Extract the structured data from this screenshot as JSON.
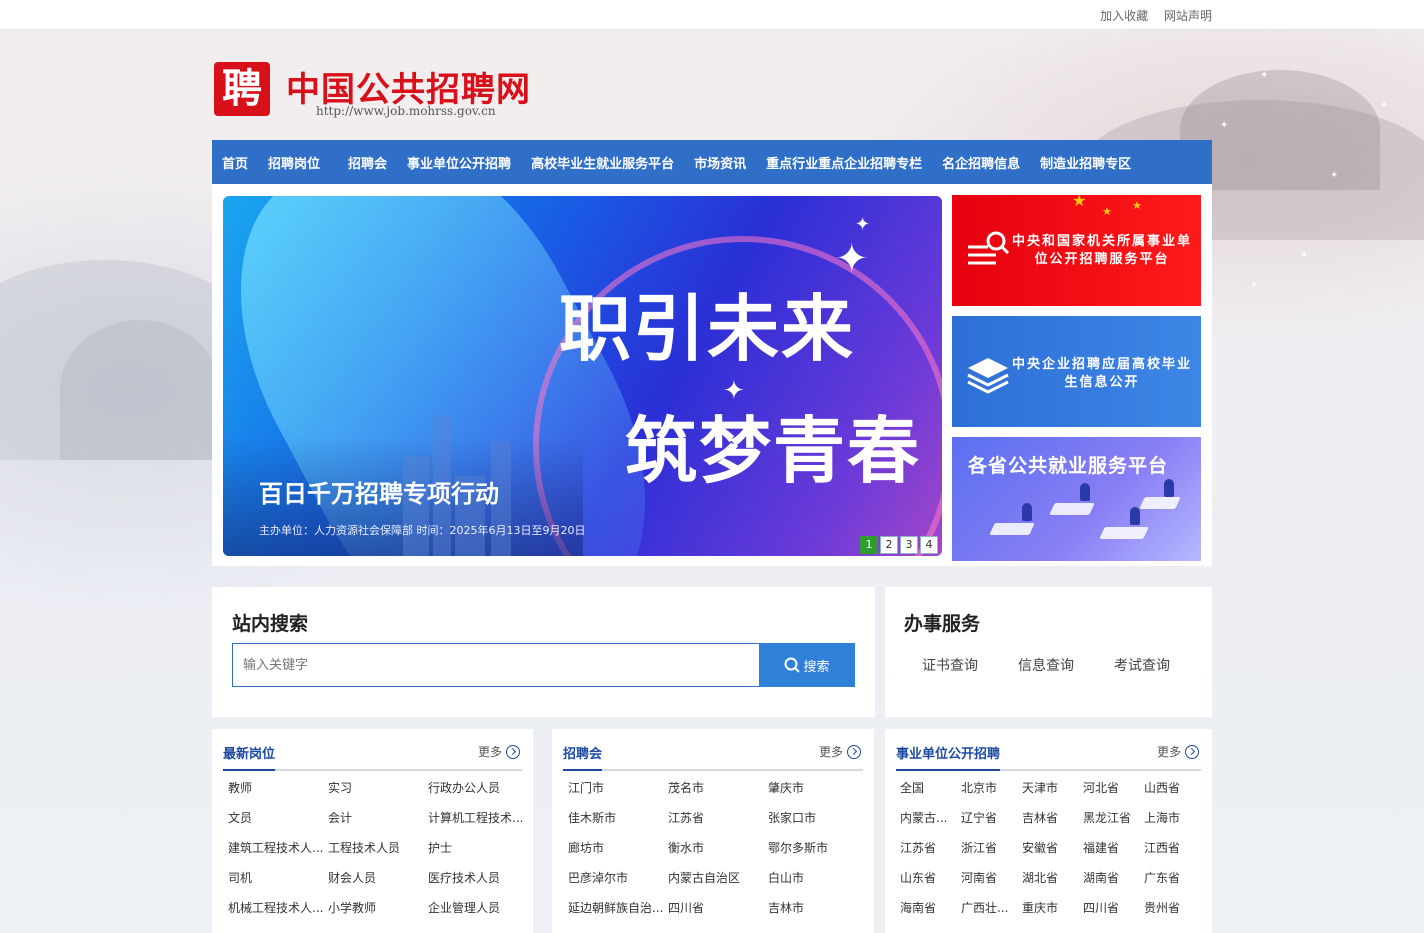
{
  "topbar": {
    "links": [
      "加入收藏",
      "网站声明"
    ]
  },
  "logo": {
    "mark": "聘",
    "title": "中国公共招聘网",
    "url": "http://www.job.mohrss.gov.cn"
  },
  "nav": [
    "首页",
    "招聘岗位",
    "招聘会",
    "事业单位公开招聘",
    "高校毕业生就业服务平台",
    "市场资讯",
    "重点行业重点企业招聘专栏",
    "名企招聘信息",
    "制造业招聘专区"
  ],
  "carousel": {
    "line1": "职引未来",
    "line2": "筑梦青春",
    "subtitle": "百日千万招聘专项行动",
    "sponsor": "主办单位：人力资源社会保障部    时间：2025年6月13日至9月20日",
    "dots": [
      "1",
      "2",
      "3",
      "4"
    ],
    "active_dot": 1
  },
  "side_banners": [
    {
      "text": "中央和国家机关所属事业单位公开招聘服务平台",
      "icon": "search-list-icon",
      "color": "#e5000f"
    },
    {
      "text": "中央企业招聘应届高校毕业生信息公开",
      "icon": "layers-icon",
      "color": "#2d6fd6"
    },
    {
      "text": "各省公共就业服务平台",
      "icon": "office-illustration",
      "color": "#6a72f0"
    }
  ],
  "search": {
    "title": "站内搜索",
    "placeholder": "输入关键字",
    "button": "搜索"
  },
  "service": {
    "title": "办事服务",
    "links": [
      "证书查询",
      "信息查询",
      "考试查询"
    ]
  },
  "lists": [
    {
      "title": "最新岗位",
      "more": "更多",
      "items": [
        "教师",
        "实习",
        "行政办公人员",
        "文员",
        "会计",
        "计算机工程技术...",
        "建筑工程技术人...",
        "工程技术人员",
        "护士",
        "司机",
        "财会人员",
        "医疗技术人员",
        "机械工程技术人...",
        "小学教师",
        "企业管理人员"
      ]
    },
    {
      "title": "招聘会",
      "more": "更多",
      "items": [
        "江门市",
        "茂名市",
        "肇庆市",
        "佳木斯市",
        "江苏省",
        "张家口市",
        "廊坊市",
        "衡水市",
        "鄂尔多斯市",
        "巴彦淖尔市",
        "内蒙古自治区",
        "白山市",
        "延边朝鲜族自治...",
        "四川省",
        "吉林市"
      ]
    },
    {
      "title": "事业单位公开招聘",
      "more": "更多",
      "items": [
        "全国",
        "北京市",
        "天津市",
        "河北省",
        "山西省",
        "内蒙古...",
        "辽宁省",
        "吉林省",
        "黑龙江省",
        "上海市",
        "江苏省",
        "浙江省",
        "安徽省",
        "福建省",
        "江西省",
        "山东省",
        "河南省",
        "湖北省",
        "湖南省",
        "广东省",
        "海南省",
        "广西壮...",
        "重庆市",
        "四川省",
        "贵州省"
      ]
    }
  ]
}
